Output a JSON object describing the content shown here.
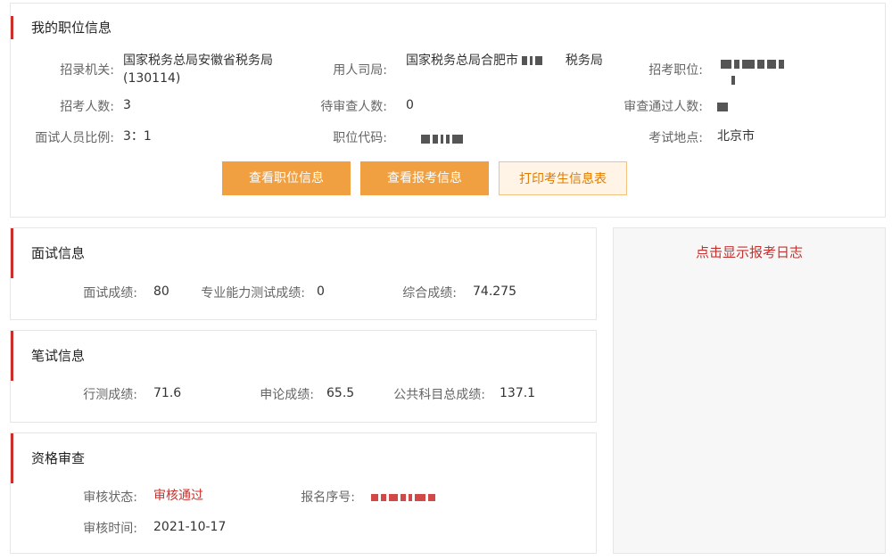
{
  "position_info": {
    "title": "我的职位信息",
    "labels": {
      "agency": "招录机关:",
      "department": "用人司局:",
      "position": "招考职位:",
      "recruit_count": "招考人数:",
      "pending_count": "待审查人数:",
      "passed_count": "审查通过人数:",
      "interview_ratio": "面试人员比例:",
      "position_code": "职位代码:",
      "exam_location": "考试地点:"
    },
    "values": {
      "agency": "国家税务总局安徽省税务局(130114)",
      "department": "国家税务总局合肥市",
      "department_suffix": "税务局",
      "recruit_count": "3",
      "pending_count": "0",
      "interview_ratio": "3：1",
      "exam_location": "北京市"
    },
    "buttons": {
      "view_position": "查看职位信息",
      "view_application": "查看报考信息",
      "print_form": "打印考生信息表"
    }
  },
  "interview": {
    "title": "面试信息",
    "labels": {
      "interview_score": "面试成绩:",
      "professional_score": "专业能力测试成绩:",
      "total_score": "综合成绩:"
    },
    "values": {
      "interview_score": "80",
      "professional_score": "0",
      "total_score": "74.275"
    }
  },
  "written": {
    "title": "笔试信息",
    "labels": {
      "xingce": "行测成绩:",
      "shenlun": "申论成绩:",
      "public_total": "公共科目总成绩:"
    },
    "values": {
      "xingce": "71.6",
      "shenlun": "65.5",
      "public_total": "137.1"
    }
  },
  "qualification": {
    "title": "资格审查",
    "labels": {
      "status": "审核状态:",
      "reg_number": "报名序号:",
      "review_time": "审核时间:"
    },
    "values": {
      "status": "审核通过",
      "review_time": "2021-10-17"
    }
  },
  "log_panel": {
    "link": "点击显示报考日志"
  },
  "colors": {
    "accent_red": "#c9302c",
    "button_orange": "#f0a040"
  }
}
